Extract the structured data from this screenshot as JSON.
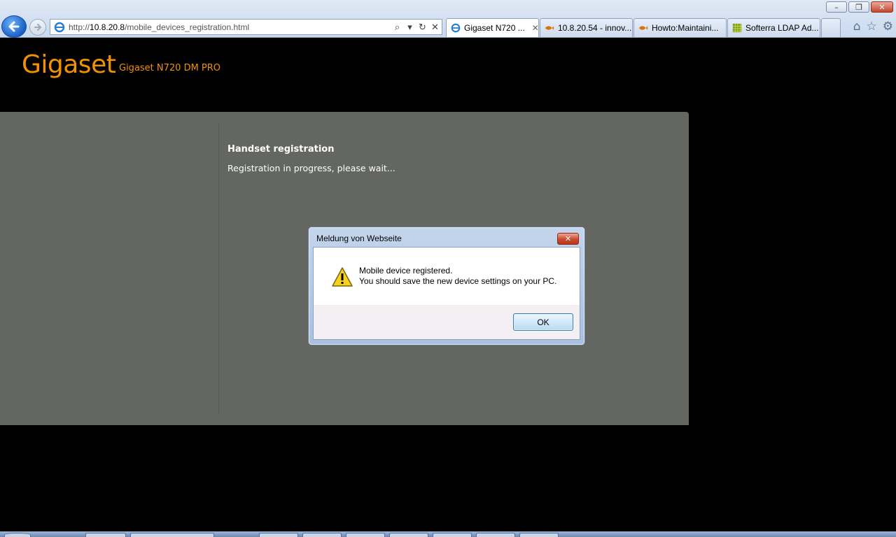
{
  "browser": {
    "url_prefix": "http://",
    "url_host": "10.8.20.8",
    "url_path": "/mobile_devices_registration.html",
    "tabs": [
      {
        "label": "Gigaset N720 ...",
        "active": true,
        "close": "✕"
      },
      {
        "label": "10.8.20.54 - innov...",
        "active": false
      },
      {
        "label": "Howto:Maintaini...",
        "active": false
      },
      {
        "label": "Softerra LDAP Ad...",
        "active": false
      }
    ]
  },
  "page": {
    "logo": "Gigaset",
    "product": "Gigaset N720 DM PRO",
    "heading": "Handset registration",
    "status": "Registration in progress, please wait..."
  },
  "dialog": {
    "title": "Meldung von Webseite",
    "message_line1": "Mobile device registered.",
    "message_line2": "You should save the new device settings on your PC.",
    "ok_label": "OK"
  },
  "colors": {
    "brand_orange": "#f39200",
    "panel_gray": "#646662",
    "background": "#000000"
  }
}
